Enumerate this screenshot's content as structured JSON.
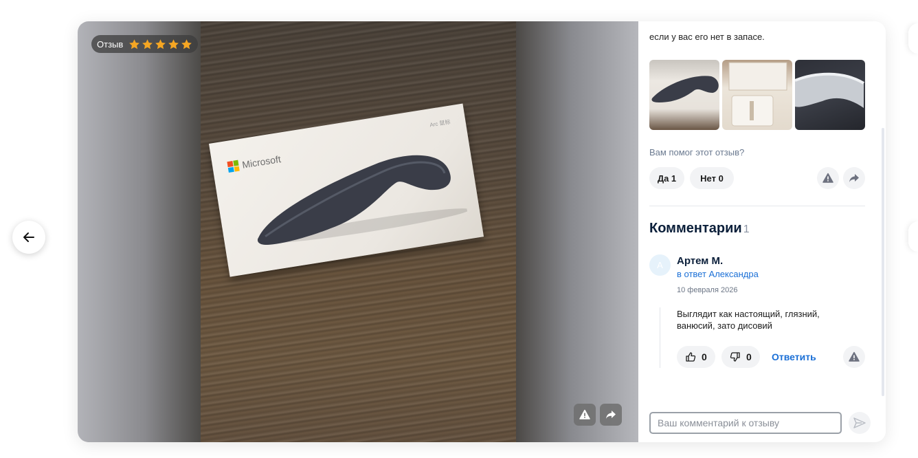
{
  "review_badge": {
    "label": "Отзыв",
    "rating": 5,
    "max_rating": 5
  },
  "photo": {
    "brand_text": "Microsoft",
    "corner_text": "Arc 鼠标"
  },
  "review": {
    "text_tail": "если у вас его нет в запасе.",
    "thumbnail_count": 3
  },
  "helpful": {
    "question": "Вам помог этот отзыв?",
    "yes_label": "Да 1",
    "no_label": "Нет 0"
  },
  "comments": {
    "title": "Комментарии",
    "count": "1",
    "items": [
      {
        "avatar_letter": "А",
        "author": "Артем М.",
        "reply_to": "в ответ Александра",
        "date": "10 февраля 2026",
        "text": "Выглядит как настоящий, глязний, ванюсий, зато дисовий",
        "likes": "0",
        "dislikes": "0",
        "reply_label": "Ответить"
      }
    ]
  },
  "comment_input": {
    "placeholder": "Ваш комментарий к отзыву"
  },
  "colors": {
    "accent": "#1a6fd6",
    "star": "#f5a623",
    "title": "#0b1f3a"
  },
  "icons": [
    "arrow-left-icon",
    "star-icon",
    "alert-icon",
    "share-icon",
    "like-icon",
    "dislike-icon",
    "send-icon"
  ]
}
